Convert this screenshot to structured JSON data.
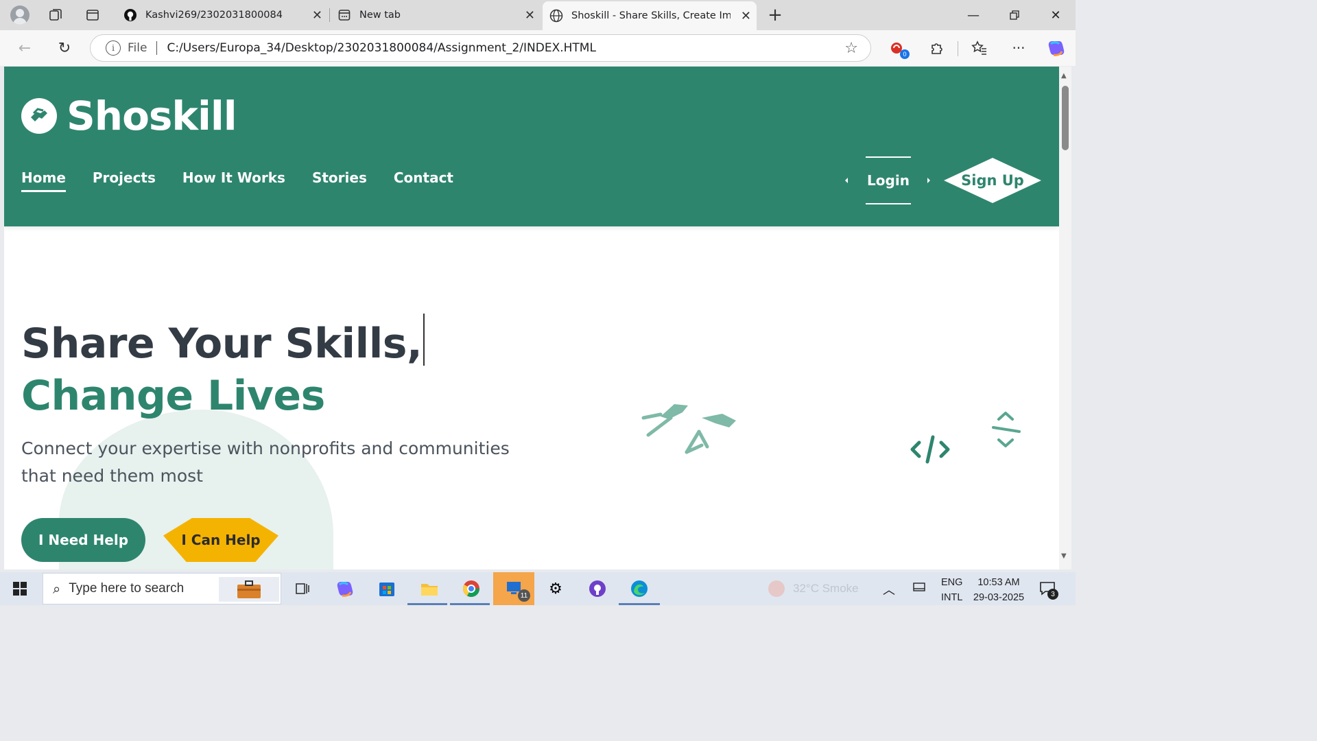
{
  "browser": {
    "tabs": [
      {
        "title": "Kashvi269/2302031800084",
        "icon": "github-icon"
      },
      {
        "title": "New tab",
        "icon": "newtab-icon"
      },
      {
        "title": "Shoskill - Share Skills, Create Impact",
        "icon": "globe-icon",
        "active": true
      }
    ],
    "address": {
      "scheme": "File",
      "url": "C:/Users/Europa_34/Desktop/2302031800084/Assignment_2/INDEX.HTML"
    },
    "notification_count": "0"
  },
  "site": {
    "brand": "Shoskill",
    "nav": [
      "Home",
      "Projects",
      "How It Works",
      "Stories",
      "Contact"
    ],
    "login": "Login",
    "signup": "Sign Up",
    "hero": {
      "title_line1": "Share Your Skills,",
      "title_line2": "Change Lives",
      "subtitle": "Connect your expertise with nonprofits and communities that need them most",
      "btn_need": "I Need Help",
      "btn_can": "I Can Help"
    },
    "colors": {
      "primary": "#2e856e",
      "accent": "#f5b301",
      "text": "#333b45"
    }
  },
  "taskbar": {
    "search_placeholder": "Type here to search",
    "weather": "32°C  Smoke",
    "lang1": "ENG",
    "lang2": "INTL",
    "time": "10:53 AM",
    "date": "29-03-2025",
    "notif_count": "3",
    "badge_11": "11"
  }
}
